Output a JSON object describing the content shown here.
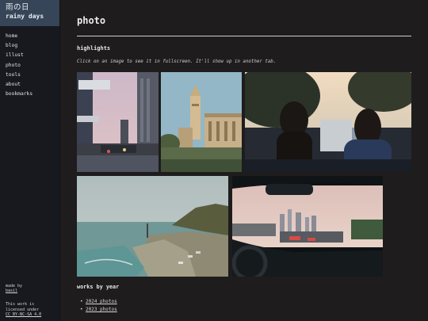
{
  "brand": {
    "title_jp": "雨の日",
    "title_en": "rainy days"
  },
  "nav": [
    {
      "label": "home"
    },
    {
      "label": "blog"
    },
    {
      "label": "illust"
    },
    {
      "label": "photo"
    },
    {
      "label": "tools"
    },
    {
      "label": "about"
    },
    {
      "label": "bookmarks"
    }
  ],
  "footer": {
    "made_by": "made by",
    "author": "basil",
    "license_line1": "This work is",
    "license_line2": "licensed under",
    "license_link": "CC BY-NC-SA 4.0"
  },
  "main": {
    "title": "photo",
    "highlights_title": "highlights",
    "hint": "Click on an image to see it in fullscreen. It'll show up in another tab.",
    "works_title": "works by year",
    "works": [
      {
        "label": "2024 photos"
      },
      {
        "label": "2023 photos"
      }
    ]
  },
  "photos": [
    {
      "name": "city-street-photo",
      "colors": [
        "#c7b9c7",
        "#5b5f6d",
        "#2e3038"
      ]
    },
    {
      "name": "clock-tower-photo",
      "colors": [
        "#8fb5c4",
        "#b39a78",
        "#3a4a35"
      ]
    },
    {
      "name": "silhouettes-sunset-photo",
      "colors": [
        "#e6c9a5",
        "#28303a",
        "#1a1d24"
      ]
    },
    {
      "name": "coastal-town-photo",
      "colors": [
        "#a9b8b9",
        "#6a8a87",
        "#3b4a3e"
      ]
    },
    {
      "name": "car-windshield-city-photo",
      "colors": [
        "#d9c3bf",
        "#2a2f37",
        "#0f1216"
      ]
    }
  ]
}
